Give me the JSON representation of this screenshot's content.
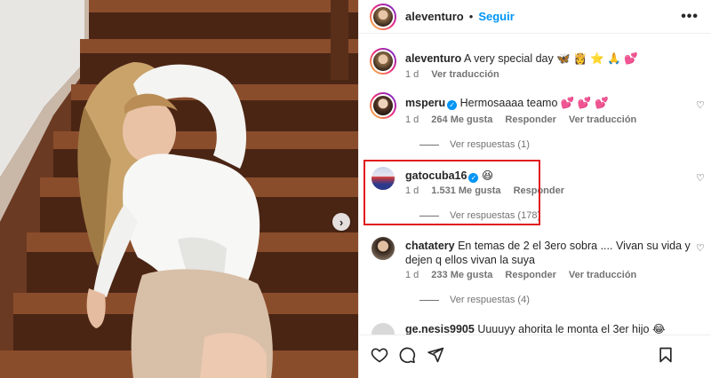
{
  "header": {
    "username": "aleventuro",
    "separator": "•",
    "follow_label": "Seguir",
    "more_label": "•••"
  },
  "caption": {
    "username": "aleventuro",
    "text": "A very special day 🦋 👸 ⭐ 🙏 💕",
    "time": "1 d",
    "translate_label": "Ver traducción"
  },
  "comments": [
    {
      "username": "msperu",
      "verified": true,
      "text": "Hermosaaaa teamo 💕 💕 💕",
      "time": "1 d",
      "likes": "264 Me gusta",
      "reply_label": "Responder",
      "translate_label": "Ver traducción",
      "view_replies": "Ver respuestas (1)"
    },
    {
      "username": "gatocuba16",
      "verified": true,
      "text": "😆",
      "time": "1 d",
      "likes": "1.531 Me gusta",
      "reply_label": "Responder",
      "view_replies": "Ver respuestas (178)"
    },
    {
      "username": "chatatery",
      "verified": false,
      "text": "En temas de 2 el 3ero sobra .... Vivan su vida y dejen q ellos vivan la suya",
      "time": "1 d",
      "likes": "233 Me gusta",
      "reply_label": "Responder",
      "translate_label": "Ver traducción",
      "view_replies": "Ver respuestas (4)"
    },
    {
      "username": "ge.nesis9905",
      "verified": false,
      "text": "Uuuuyy ahorita le monta el 3er hijo 😂"
    }
  ],
  "icons": {
    "next": "chevron-right-icon",
    "like": "heart-icon",
    "comment": "comment-icon",
    "share": "send-icon",
    "save": "bookmark-icon"
  },
  "colors": {
    "accent": "#0095f6",
    "highlight": "#e01b1b",
    "muted": "#737373"
  }
}
